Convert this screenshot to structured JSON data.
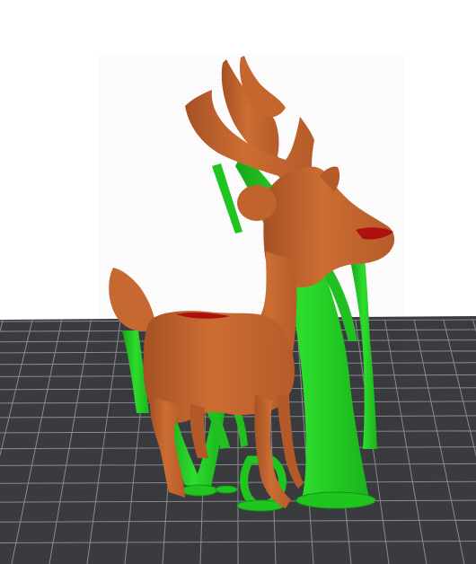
{
  "viewport": {
    "background_color": "#ffffff",
    "bed_color": "#3a3b3f",
    "bed_grid_color": "#8a8b90"
  },
  "model": {
    "body_color": "#c8692f",
    "body_highlight": "#dd8a48",
    "body_shadow": "#9a4a1e",
    "support_color": "#1fc81f",
    "support_highlight": "#38e838",
    "support_shadow": "#14961a",
    "layer_top_color": "#b01010"
  }
}
